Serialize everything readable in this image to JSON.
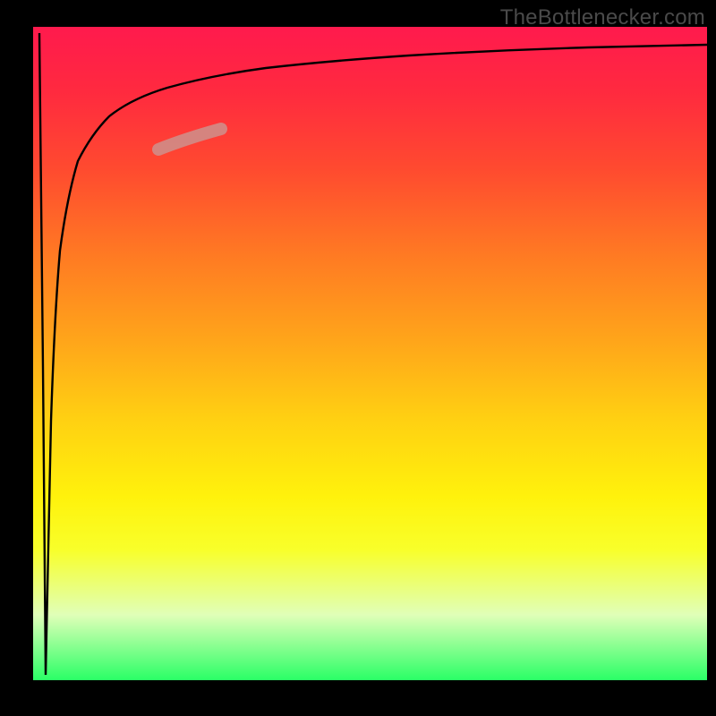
{
  "attribution": "TheBottlenecker.com",
  "chart_data": {
    "type": "line",
    "title": "",
    "xlabel": "",
    "ylabel": "",
    "xlim": [
      0,
      100
    ],
    "ylim": [
      0,
      100
    ],
    "grid": false,
    "background_gradient": [
      "#ff1a4d",
      "#ff7a23",
      "#fff20c",
      "#2aff66"
    ],
    "series": [
      {
        "name": "bottleneck-curve",
        "x": [
          0,
          0.5,
          1,
          1.5,
          2,
          2.5,
          3,
          4,
          5,
          6,
          8,
          10,
          12,
          15,
          20,
          25,
          30,
          40,
          50,
          60,
          70,
          80,
          90,
          100
        ],
        "y": [
          99,
          50,
          0.5,
          40,
          58,
          68,
          73,
          79,
          82.5,
          85,
          88,
          90,
          91,
          92,
          93.2,
          94,
          94.5,
          95.2,
          95.8,
          96.2,
          96.6,
          96.9,
          97.1,
          97.3
        ]
      }
    ],
    "highlight": {
      "x_range": [
        18,
        27
      ],
      "color": "#cf8e8a",
      "width": 14
    }
  }
}
